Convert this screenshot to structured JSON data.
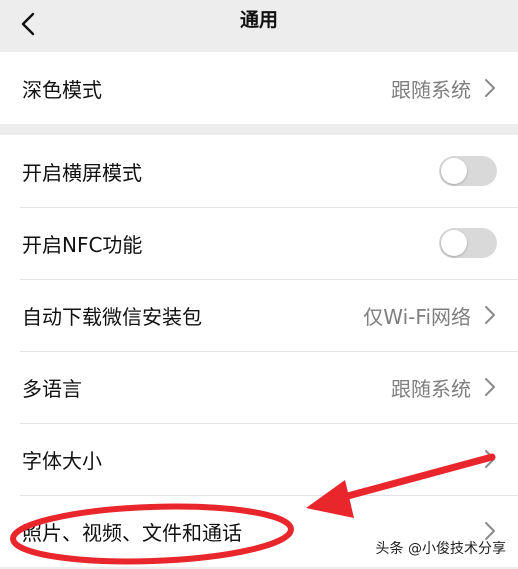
{
  "header": {
    "title": "通用"
  },
  "section_display": {
    "items": [
      {
        "label": "深色模式",
        "value": "跟随系统"
      }
    ]
  },
  "section_general": {
    "items": [
      {
        "label": "开启横屏模式",
        "toggle_on": false
      },
      {
        "label": "开启NFC功能",
        "toggle_on": false
      },
      {
        "label": "自动下载微信安装包",
        "value": "仅Wi-Fi网络"
      },
      {
        "label": "多语言",
        "value": "跟随系统"
      },
      {
        "label": "字体大小",
        "value": ""
      },
      {
        "label": "照片、视频、文件和通话",
        "value": ""
      }
    ]
  },
  "annotation": {
    "color": "#e8262b"
  },
  "watermark": {
    "text": "头条 @小俊技术分享"
  },
  "colors": {
    "background": "#ededed",
    "cell": "#ffffff",
    "secondary_text": "#7f7f7f",
    "toggle_off": "#d9d9d9"
  }
}
